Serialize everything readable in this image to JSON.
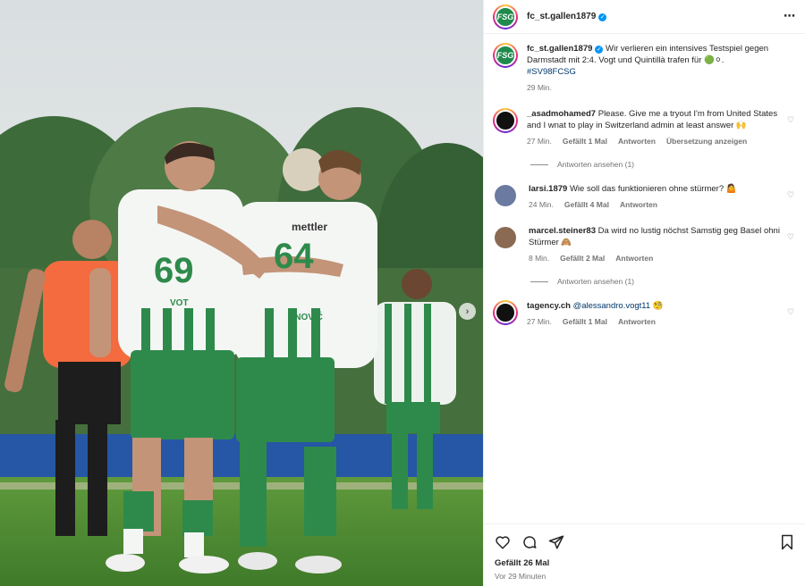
{
  "post": {
    "username": "fc_st.gallen1879",
    "verified_mark": "✓",
    "more_icon": "⋯",
    "avatar_text": "FSG"
  },
  "caption": {
    "username": "fc_st.gallen1879",
    "text": "Wir verlieren ein intensives Testspiel gegen Darmstadt mit 2:4. Vogt und Quintillà trafen für 🟢⚪.",
    "hashtag": "#SV98FCSG",
    "time": "29 Min."
  },
  "comments": [
    {
      "username": "_asadmohamed7",
      "text": "Please. Give me a tryout I'm from United States and I wnat to play in Switzerland admin at least answer 🙌",
      "time": "27 Min.",
      "likes": "Gefällt 1 Mal",
      "reply": "Antworten",
      "translate": "Übersetzung anzeigen",
      "view_replies": "Antworten ansehen (1)"
    },
    {
      "username": "larsi.1879",
      "text": "Wie soll das funktionieren ohne stürmer? 🤷",
      "time": "24 Min.",
      "likes": "Gefällt 4 Mal",
      "reply": "Antworten"
    },
    {
      "username": "marcel.steiner83",
      "text": "Da wird no lustig nöchst Samstig geg Basel ohni Stürmer 🙈",
      "time": "8 Min.",
      "likes": "Gefällt 2 Mal",
      "reply": "Antworten",
      "view_replies": "Antworten ansehen (1)"
    },
    {
      "username": "tagency.ch",
      "mention": "@alessandro.vogt11",
      "emoji": "🧐",
      "time": "27 Min.",
      "likes": "Gefällt 1 Mal",
      "reply": "Antworten"
    }
  ],
  "footer": {
    "likes": "Gefällt 26 Mal",
    "time": "Vor 29 Minuten"
  },
  "photo": {
    "jersey_numbers": [
      "69",
      "64"
    ],
    "jersey_sponsor": "mettler",
    "player_names": [
      "VOT",
      "ANOVIĆ"
    ],
    "next_icon": "›"
  },
  "icons": [
    "heart-icon",
    "comment-icon",
    "share-icon",
    "bookmark-icon",
    "chevron-right-icon",
    "more-icon",
    "verified-icon"
  ],
  "colors": {
    "accent_link": "#00376b",
    "club_green": "#1f8a4c",
    "verified": "#0095f6",
    "referee": "#f36b3f"
  }
}
